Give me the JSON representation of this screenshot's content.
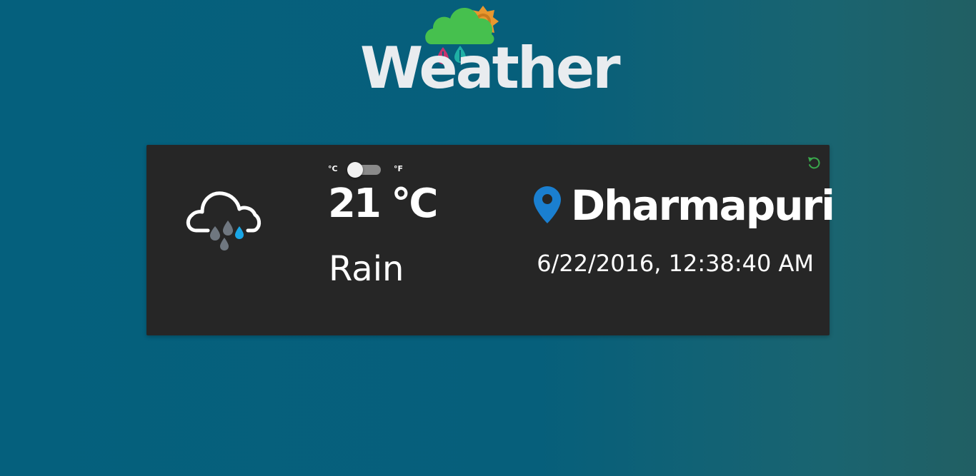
{
  "header": {
    "logo_icon": "weather-logo-icon",
    "title": "Weather",
    "colors": {
      "cloud": "#46c04e",
      "sun": "#e8972e",
      "drop_left": "#c3336e",
      "drop_right": "#1fb0a5"
    }
  },
  "card": {
    "weather_icon": "rain-cloud-icon",
    "unit_toggle": {
      "celsius_label": "°C",
      "fahrenheit_label": "°F",
      "selected": "°C"
    },
    "temperature": "21 °C",
    "condition": "Rain",
    "location_icon": "map-pin-icon",
    "location_color": "#1a7fd0",
    "city": "Dharmapuri",
    "datetime": "6/22/2016, 12:38:40 AM",
    "refresh_icon": "refresh-icon",
    "refresh_color": "#3aa94c",
    "background": "#262626"
  }
}
